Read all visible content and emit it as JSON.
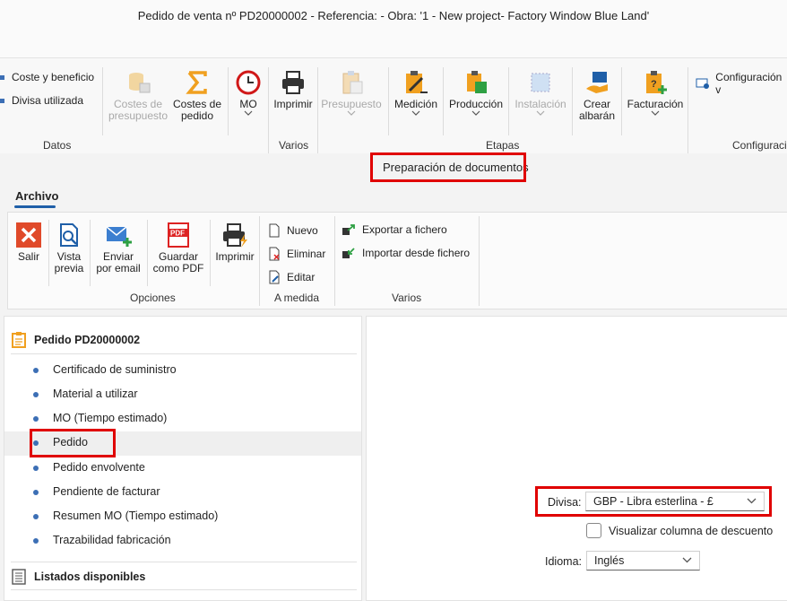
{
  "window": {
    "title": "Pedido de venta nº PD20000002 - Referencia:  - Obra: '1 - New project- Factory Window Blue Land'"
  },
  "ribbon": {
    "datos": {
      "coste_beneficio": "Coste y beneficio",
      "divisa_utilizada": "Divisa utilizada",
      "costes_presupuesto_1": "Costes de",
      "costes_presupuesto_2": "presupuesto",
      "costes_pedido_1": "Costes de",
      "costes_pedido_2": "pedido",
      "mo": "MO",
      "group": "Datos"
    },
    "varios": {
      "imprimir": "Imprimir",
      "group": "Varios"
    },
    "etapas": {
      "presupuesto": "Presupuesto",
      "medicion": "Medición",
      "produccion": "Producción",
      "instalacion": "Instalación",
      "crear_albaran_1": "Crear",
      "crear_albaran_2": "albarán",
      "facturacion": "Facturación",
      "group": "Etapas"
    },
    "config": {
      "configuracion": "Configuración v",
      "group": "Configuraci"
    }
  },
  "panel_title": "Preparación de documentos",
  "tabs": [
    "Archivo"
  ],
  "ribbon2": {
    "opciones": {
      "salir": "Salir",
      "vista_previa_1": "Vista",
      "vista_previa_2": "previa",
      "enviar_1": "Enviar",
      "enviar_2": "por email",
      "guardar_1": "Guardar",
      "guardar_2": "como PDF",
      "imprimir": "Imprimir",
      "group": "Opciones"
    },
    "a_medida": {
      "nuevo": "Nuevo",
      "eliminar": "Eliminar",
      "editar": "Editar",
      "group": "A medida"
    },
    "varios": {
      "exportar": "Exportar a fichero",
      "importar": "Importar desde fichero",
      "group": "Varios"
    }
  },
  "tree": {
    "root": "Pedido PD20000002",
    "items": [
      "Certificado de suministro",
      "Material a utilizar",
      "MO (Tiempo estimado)",
      "Pedido",
      "Pedido envolvente",
      "Pendiente de facturar",
      "Resumen MO (Tiempo estimado)",
      "Trazabilidad fabricación"
    ],
    "selected": "Pedido",
    "listados": "Listados disponibles"
  },
  "form": {
    "divisa_label": "Divisa:",
    "divisa_value": "GBP  -  Libra esterlina  -  £",
    "descuento_label": "Visualizar columna de descuento",
    "descuento_checked": false,
    "idioma_label": "Idioma:",
    "idioma_value": "Inglés"
  },
  "colors": {
    "accent": "#1f5fa8",
    "highlight_box": "#e00000",
    "bullet": "#3c6fb5"
  }
}
